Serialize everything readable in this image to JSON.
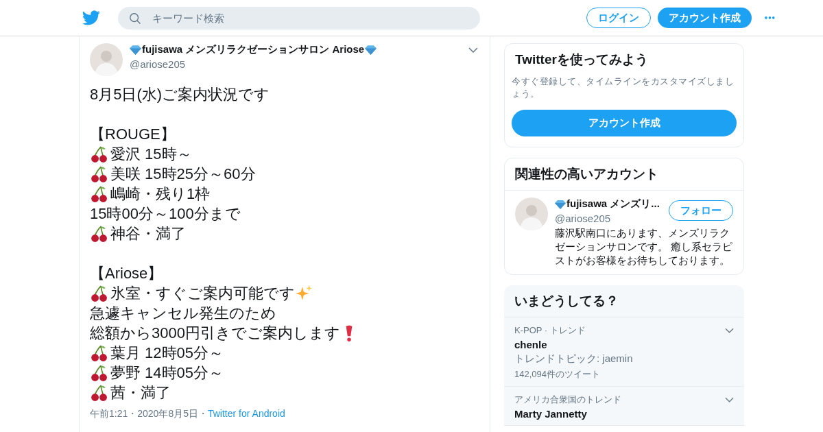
{
  "header": {
    "search": {
      "placeholder": "キーワード検索"
    },
    "login": "ログイン",
    "signup": "アカウント作成",
    "more": "•••"
  },
  "tweet": {
    "author": {
      "name": "fujisawa メンズリラクゼーションサロン Ariose",
      "handle": "@ariose205"
    },
    "lines": [
      {
        "kind": "plain",
        "text": "8月5日(水)ご案内状況です"
      },
      {
        "kind": "blank"
      },
      {
        "kind": "plain",
        "text": "【ROUGE】"
      },
      {
        "kind": "cherry",
        "text": "愛沢 15時～"
      },
      {
        "kind": "cherry",
        "text": "美咲 15時25分～60分"
      },
      {
        "kind": "cherry",
        "text": "嶋崎・残り1枠"
      },
      {
        "kind": "plain",
        "text": "15時00分～100分まで"
      },
      {
        "kind": "cherry",
        "text": "神谷・満了"
      },
      {
        "kind": "blank"
      },
      {
        "kind": "plain",
        "text": "【Ariose】"
      },
      {
        "kind": "cherry",
        "text": "氷室・すぐご案内可能です",
        "sparkles": true
      },
      {
        "kind": "plain",
        "text": "急遽キャンセル発生のため"
      },
      {
        "kind": "plain",
        "text": "総額から3000円引きでご案内します",
        "alert": true
      },
      {
        "kind": "cherry",
        "text": "葉月 12時05分～"
      },
      {
        "kind": "cherry",
        "text": "夢野 14時05分～"
      },
      {
        "kind": "cherry",
        "text": "茜・満了"
      }
    ],
    "meta": "午前1:21・2020年8月5日・",
    "source": "Twitter for Android"
  },
  "signup_card": {
    "title": "Twitterを使ってみよう",
    "text": "今すぐ登録して、タイムラインをカスタマイズしましょう。",
    "button": "アカウント作成"
  },
  "related": {
    "title": "関連性の高いアカウント",
    "accounts": [
      {
        "name": "fujisawa メンズリ...",
        "handle": "@ariose205",
        "follow": "フォロー",
        "bio": "藤沢駅南口にあります、メンズリラクゼーションサロンです。 癒し系セラピストがお客様をお待ちしております。"
      }
    ]
  },
  "trends": {
    "title": "いまどうしてる？",
    "items": [
      {
        "category": "K-POP · トレンド",
        "name": "chenle",
        "topic": "トレンドトピック: jaemin",
        "count": "142,094件のツイート"
      },
      {
        "category": "アメリカ合衆国のトレンド",
        "name": "Marty Jannetty"
      }
    ]
  }
}
